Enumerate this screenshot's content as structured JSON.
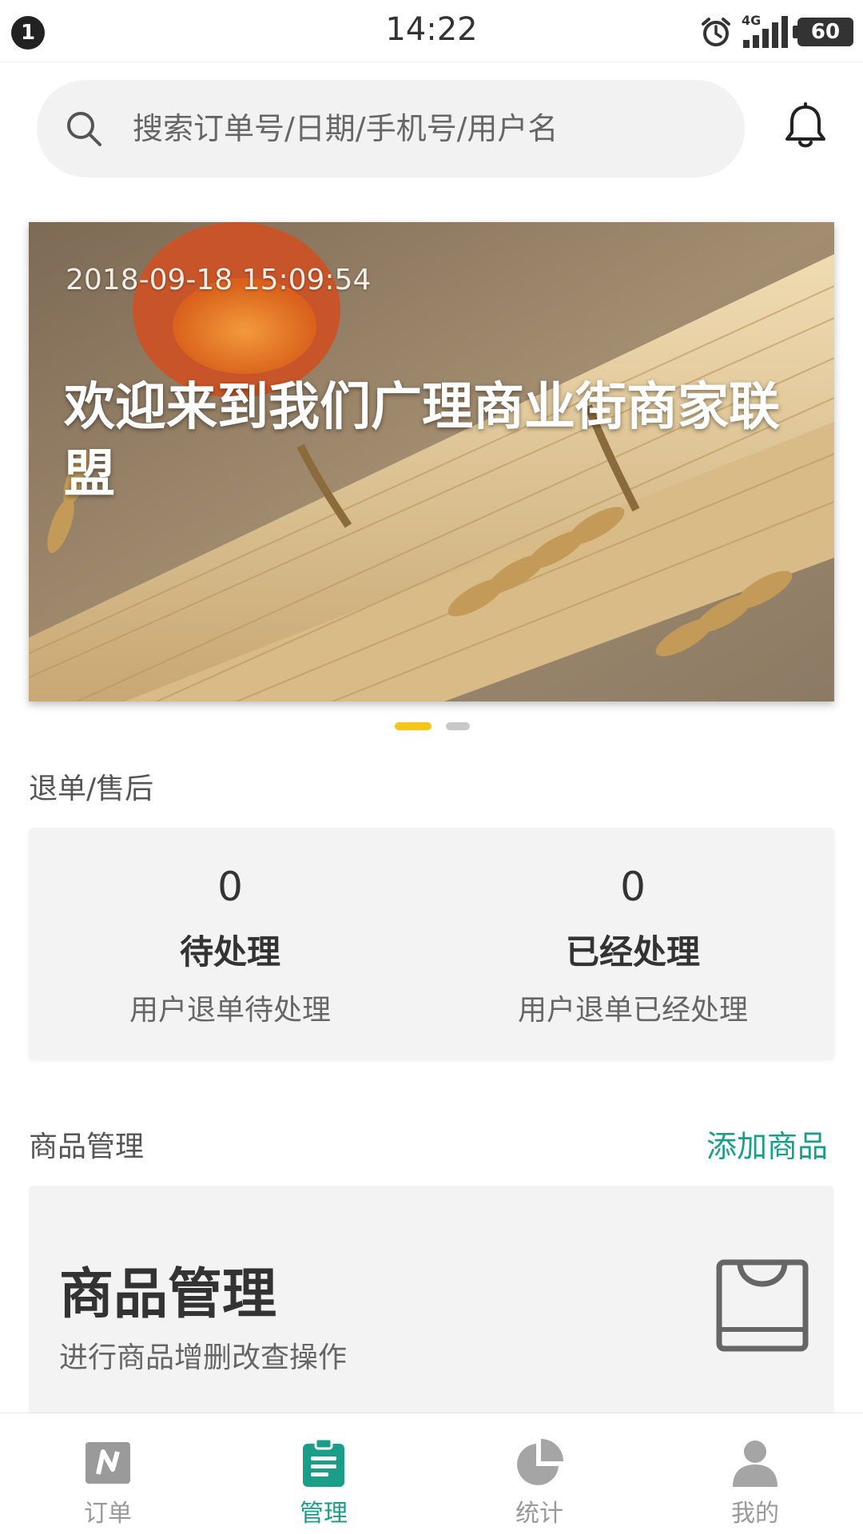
{
  "status_bar": {
    "notification_count": "1",
    "time": "14:22",
    "network": "4G",
    "battery": "60"
  },
  "search": {
    "placeholder": "搜索订单号/日期/手机号/用户名"
  },
  "banner": {
    "date": "2018-09-18 15:09:54",
    "title": "欢迎来到我们广理商业街商家联盟",
    "page_count": 2,
    "active_index": 0
  },
  "refund_section": {
    "title": "退单/售后",
    "pending": {
      "count": "0",
      "label": "待处理",
      "desc": "用户退单待处理"
    },
    "processed": {
      "count": "0",
      "label": "已经处理",
      "desc": "用户退单已经处理"
    }
  },
  "goods_section": {
    "title": "商品管理",
    "add_link": "添加商品",
    "card_title": "商品管理",
    "card_desc": "进行商品增删改查操作"
  },
  "bottom_nav": {
    "items": [
      {
        "label": "订单",
        "icon": "orders-icon",
        "active": false
      },
      {
        "label": "管理",
        "icon": "manage-clipboard-icon",
        "active": true
      },
      {
        "label": "统计",
        "icon": "pie-chart-icon",
        "active": false
      },
      {
        "label": "我的",
        "icon": "user-icon",
        "active": false
      }
    ]
  },
  "colors": {
    "accent": "#1a9e8a",
    "dot_active": "#f5c518",
    "card_bg": "#f3f3f3"
  }
}
